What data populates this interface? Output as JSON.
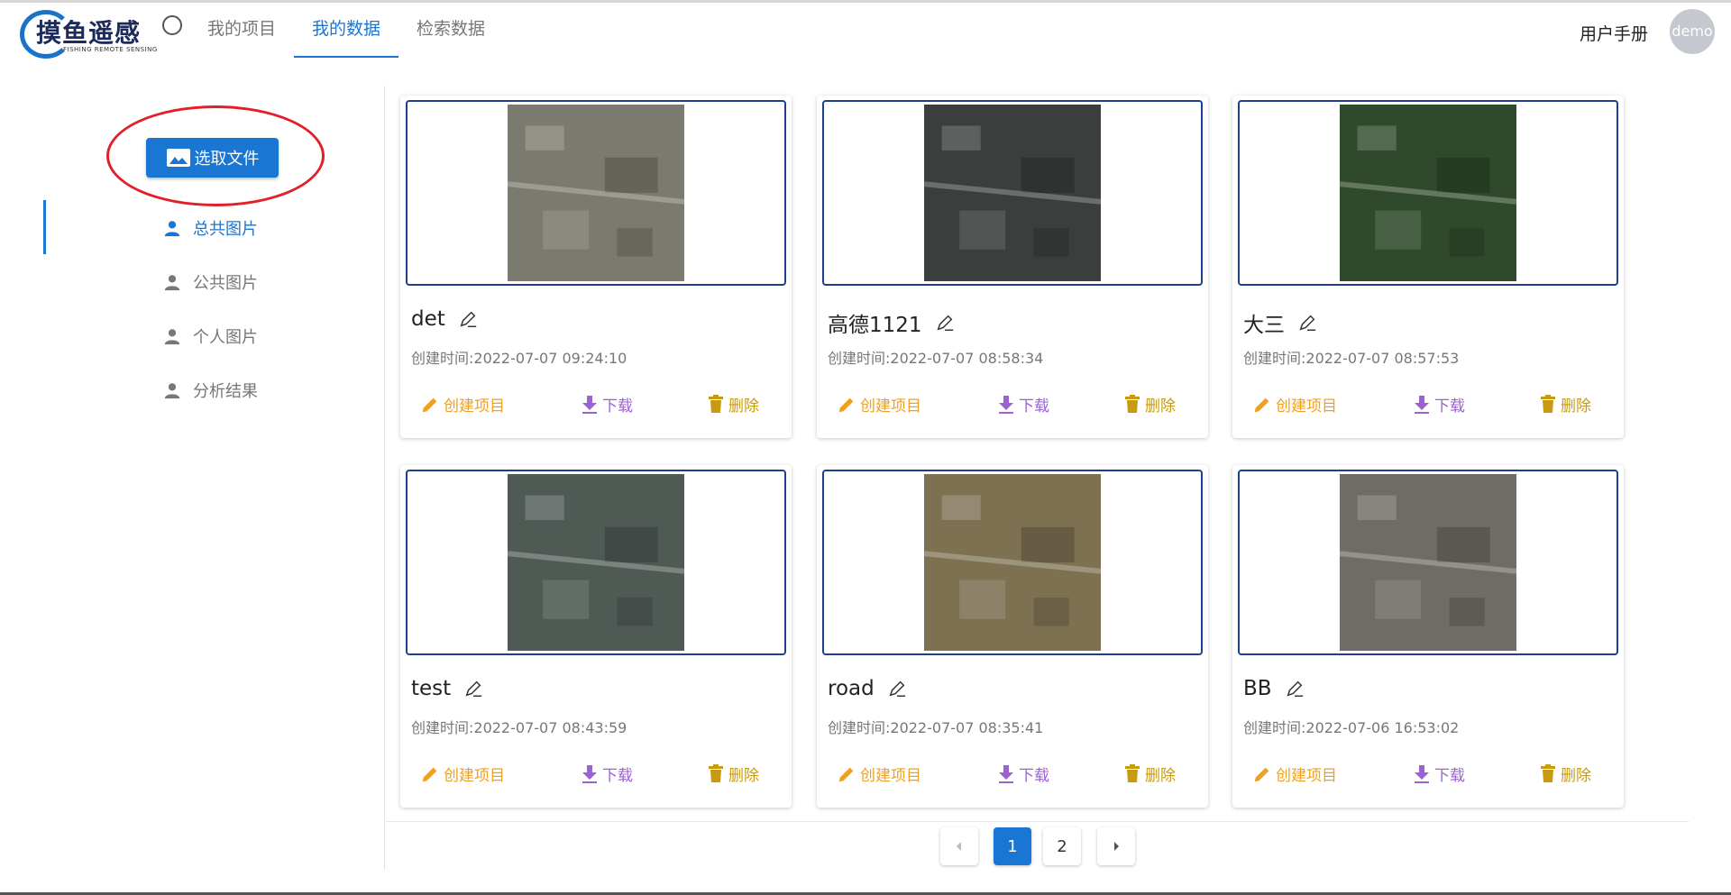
{
  "header": {
    "logo_title": "摸鱼遥感",
    "logo_subtitle": "FISHING REMOTE SENSING",
    "nav": [
      {
        "label": "我的项目",
        "active": false
      },
      {
        "label": "我的数据",
        "active": true
      },
      {
        "label": "检索数据",
        "active": false
      }
    ],
    "manual_label": "用户手册",
    "avatar_label": "demo"
  },
  "sidebar": {
    "select_button_label": "选取文件",
    "items": [
      {
        "label": "总共图片",
        "active": true
      },
      {
        "label": "公共图片",
        "active": false
      },
      {
        "label": "个人图片",
        "active": false
      },
      {
        "label": "分析结果",
        "active": false
      }
    ]
  },
  "cards": [
    {
      "name": "det",
      "time": "创建时间:2022-07-07 09:24:10",
      "thumb_color": "#7a7a6e"
    },
    {
      "name": "高德1121",
      "time": "创建时间:2022-07-07 08:58:34",
      "thumb_color": "#3a3e3c"
    },
    {
      "name": "大三",
      "time": "创建时间:2022-07-07 08:57:53",
      "thumb_color": "#2f4a2a"
    },
    {
      "name": "test",
      "time": "创建时间:2022-07-07 08:43:59",
      "thumb_color": "#4f5a55"
    },
    {
      "name": "road",
      "time": "创建时间:2022-07-07 08:35:41",
      "thumb_color": "#7d7152"
    },
    {
      "name": "BB",
      "time": "创建时间:2022-07-06 16:53:02",
      "thumb_color": "#6e6c66"
    }
  ],
  "card_actions": {
    "create_label": "创建项目",
    "download_label": "下载",
    "delete_label": "删除"
  },
  "pagination": {
    "pages": [
      "1",
      "2"
    ],
    "current": "1"
  },
  "colors": {
    "primary": "#1976d2",
    "create": "#f0a020",
    "download": "#9b62d1",
    "delete": "#c79a10",
    "annotation_circle": "#e21f2a"
  }
}
